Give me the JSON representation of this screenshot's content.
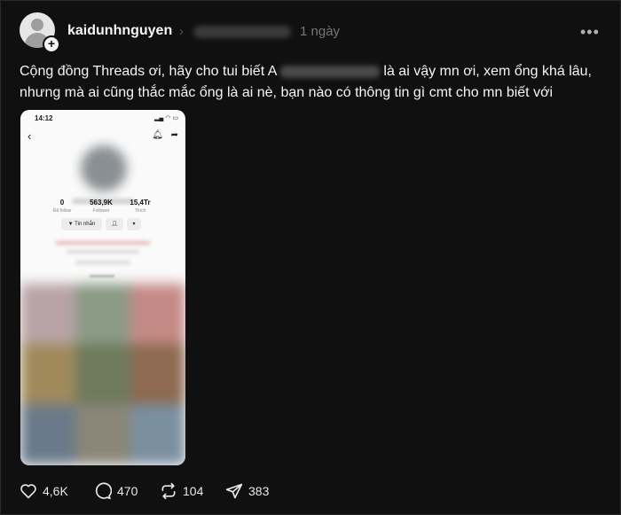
{
  "post": {
    "username": "kaidunhnguyen",
    "time_ago": "1 ngày",
    "text_line1_start": "Cộng đồng Threads ơi, hãy cho tui biết A",
    "text_line1_end": "là ai vậy mn ơi, xem ổng khá lâu,",
    "text_line2": "nhưng mà ai cũng thắc mắc ổng là ai nè, bạn nào có thông tin gì cmt cho mn biết với"
  },
  "phone": {
    "time": "14:12",
    "stats": [
      {
        "num": "0",
        "label": "Đã follow"
      },
      {
        "num": "563,9K",
        "label": "Follower"
      },
      {
        "num": "15,4Tr",
        "label": "Thích"
      }
    ],
    "message_button": "Tin nhắn"
  },
  "actions": {
    "likes": "4,6K",
    "comments": "470",
    "reposts": "104",
    "shares": "383"
  },
  "colors": {
    "background": "#101010",
    "text": "#f3f5f7",
    "muted": "#777777"
  },
  "icons": [
    "avatar-placeholder",
    "plus-icon",
    "chevron-right-icon",
    "more-icon",
    "heart-icon",
    "comment-icon",
    "repost-icon",
    "share-icon"
  ]
}
